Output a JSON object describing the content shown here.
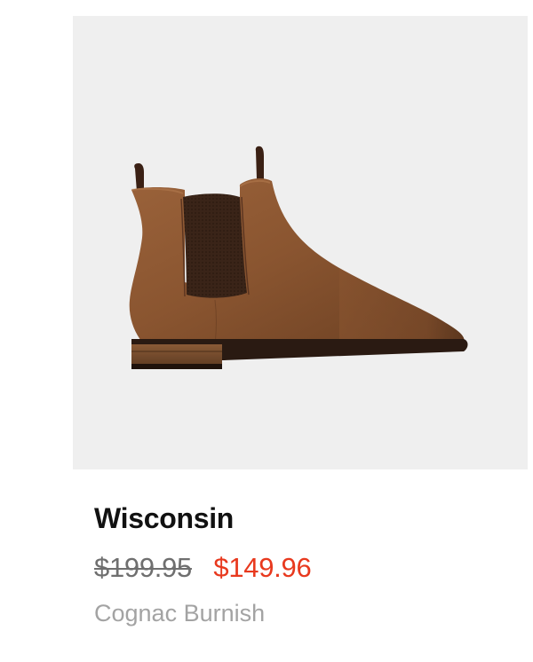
{
  "product": {
    "name": "Wisconsin",
    "original_price": "$199.95",
    "sale_price": "$149.96",
    "color_name": "Cognac Burnish",
    "image_subject": "chelsea-boot"
  },
  "colors": {
    "image_background": "#efefef",
    "name_text": "#111111",
    "original_price_text": "#6f6f6f",
    "sale_price_text": "#e8391e",
    "color_text": "#a3a3a3",
    "leather": "#8a5530",
    "elastic_panel": "#3a2418",
    "sole": "#2a1a12"
  }
}
